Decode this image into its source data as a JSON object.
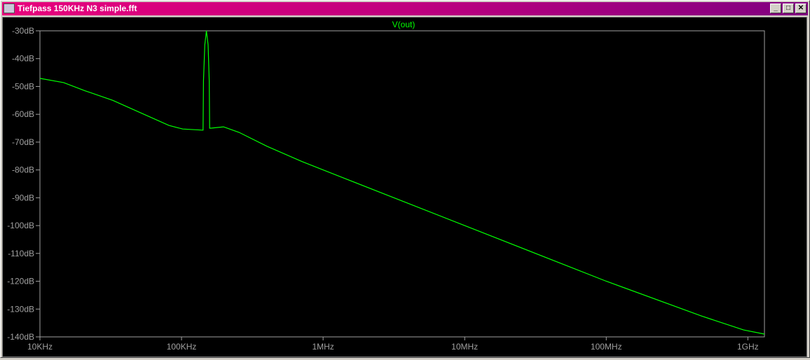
{
  "window": {
    "title": "Tiefpass 150KHz N3 simple.fft",
    "buttons": {
      "minimize": "_",
      "maximize": "□",
      "close": "✕"
    }
  },
  "colors": {
    "trace": "#00ff00",
    "axis": "#a0a0a0",
    "background": "#000000"
  },
  "chart_data": {
    "type": "line",
    "title": "V(out)",
    "xscale": "log",
    "xlim": [
      10000,
      1310000000
    ],
    "ylim": [
      -140,
      -30
    ],
    "xticks": [
      {
        "v": 10000,
        "label": "10KHz"
      },
      {
        "v": 100000,
        "label": "100KHz"
      },
      {
        "v": 1000000,
        "label": "1MHz"
      },
      {
        "v": 10000000,
        "label": "10MHz"
      },
      {
        "v": 100000000,
        "label": "100MHz"
      },
      {
        "v": 1000000000,
        "label": "1GHz"
      }
    ],
    "yticks": [
      {
        "v": -30,
        "label": "-30dB"
      },
      {
        "v": -40,
        "label": "-40dB"
      },
      {
        "v": -50,
        "label": "-50dB"
      },
      {
        "v": -60,
        "label": "-60dB"
      },
      {
        "v": -70,
        "label": "-70dB"
      },
      {
        "v": -80,
        "label": "-80dB"
      },
      {
        "v": -90,
        "label": "-90dB"
      },
      {
        "v": -100,
        "label": "-100dB"
      },
      {
        "v": -110,
        "label": "-110dB"
      },
      {
        "v": -120,
        "label": "-120dB"
      },
      {
        "v": -130,
        "label": "-130dB"
      },
      {
        "v": -140,
        "label": "-140dB"
      }
    ],
    "series": [
      {
        "name": "V(out)",
        "x": [
          10000,
          14700,
          20700,
          32700,
          51600,
          81500,
          102000,
          141000,
          142000,
          143000,
          146000,
          150000,
          154000,
          157000,
          158000,
          161000,
          198000,
          255000,
          402000,
          710000,
          1000000,
          10000000,
          100000000,
          471000000,
          933000000,
          1310000000
        ],
        "y": [
          -47.1,
          -48.6,
          -51.5,
          -55,
          -59.5,
          -64,
          -65.3,
          -65.7,
          -65.7,
          -48,
          -35,
          -30,
          -35,
          -48,
          -65,
          -65,
          -64.5,
          -66.5,
          -71.5,
          -77,
          -80,
          -100,
          -120,
          -132.5,
          -137.5,
          -139
        ]
      }
    ]
  }
}
